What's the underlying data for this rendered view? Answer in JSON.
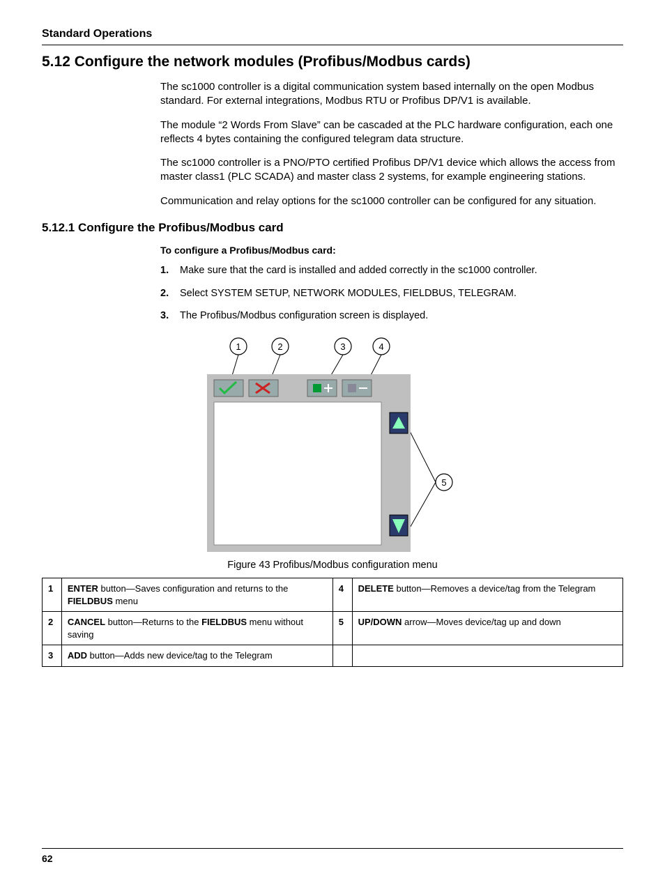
{
  "running_head": "Standard Operations",
  "h1": "5.12 Configure the network modules (Profibus/Modbus cards)",
  "paras": [
    "The sc1000 controller is a digital communication system based internally on the open Modbus standard. For external integrations, Modbus RTU or Profibus DP/V1 is available.",
    "The module “2 Words From Slave” can be cascaded at the PLC hardware configuration, each one reflects 4 bytes containing the configured telegram data structure.",
    "The sc1000 controller is a PNO/PTO certified Profibus DP/V1 device which allows the access from master class1 (PLC SCADA) and master class 2 systems, for example engineering stations.",
    "Communication and relay options for the sc1000 controller can be configured for any situation."
  ],
  "h2": "5.12.1 Configure the Profibus/Modbus card",
  "procedure_intro": "To configure a Profibus/Modbus card:",
  "steps": [
    "Make sure that the card is installed and added correctly in the sc1000 controller.",
    "Select SYSTEM SETUP, NETWORK MODULES, FIELDBUS, TELEGRAM.",
    "The Profibus/Modbus configuration screen is displayed."
  ],
  "callouts": {
    "c1": "1",
    "c2": "2",
    "c3": "3",
    "c4": "4",
    "c5": "5"
  },
  "figure_caption": "Figure 43  Profibus/Modbus configuration menu",
  "legend": [
    {
      "n": "1",
      "strong1": "ENTER",
      "mid": " button—Saves configuration and returns to the ",
      "strong2": "FIELDBUS",
      "tail": " menu"
    },
    {
      "n": "2",
      "strong1": "CANCEL",
      "mid": " button—Returns to the ",
      "strong2": "FIELDBUS",
      "tail": " menu without saving"
    },
    {
      "n": "3",
      "strong1": "ADD",
      "mid": " button—Adds new device/tag to the Telegram",
      "strong2": "",
      "tail": ""
    },
    {
      "n": "4",
      "strong1": "DELETE",
      "mid": " button—Removes a device/tag from the Telegram",
      "strong2": "",
      "tail": ""
    },
    {
      "n": "5",
      "strong1": "UP/DOWN",
      "mid": " arrow—Moves device/tag up and down",
      "strong2": "",
      "tail": ""
    }
  ],
  "page_number": "62"
}
